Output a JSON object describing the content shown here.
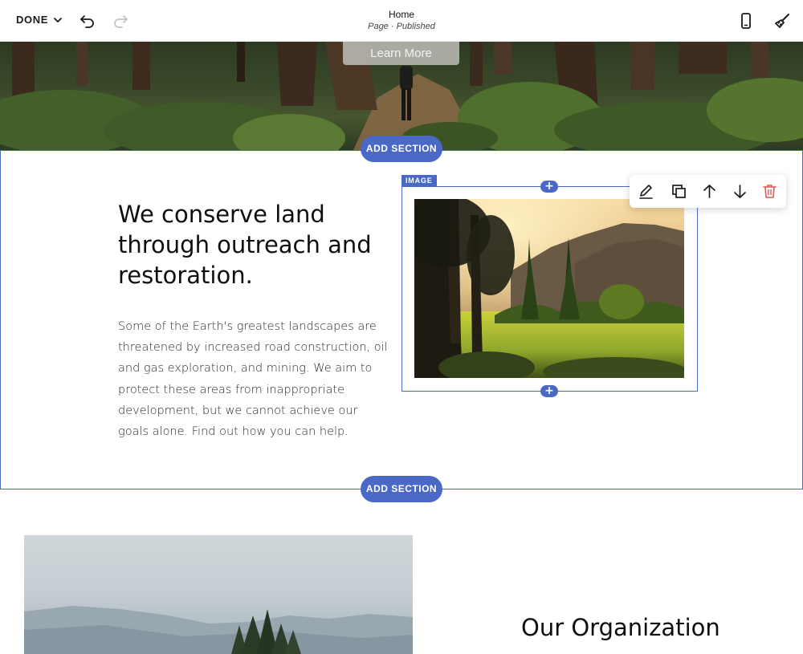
{
  "topbar": {
    "done_label": "DONE",
    "page_title": "Home",
    "page_status": "Page · Published",
    "icons": [
      "chevron-down-icon",
      "undo-icon",
      "redo-icon",
      "mobile-preview-icon",
      "site-styles-brush-icon"
    ]
  },
  "hero": {
    "button_label": "Learn More"
  },
  "add_section_label": "ADD SECTION",
  "content": {
    "heading": "We conserve land through outreach and restoration.",
    "body": "Some of the Earth's greatest landscapes are threatened by increased road construction, oil and gas exploration, and mining. We aim to protect these areas from inappropriate development, but we cannot achieve our goals alone. Find out how you can help.",
    "image_tag": "IMAGE",
    "plus_symbol": "+"
  },
  "block_toolbar": {
    "icons": [
      "edit-pencil-icon",
      "duplicate-icon",
      "move-up-icon",
      "move-down-icon",
      "delete-trash-icon"
    ],
    "delete_color": "#e5534b"
  },
  "lower": {
    "title": "Our Organization"
  },
  "colors": {
    "accent": "#4a69c6"
  }
}
